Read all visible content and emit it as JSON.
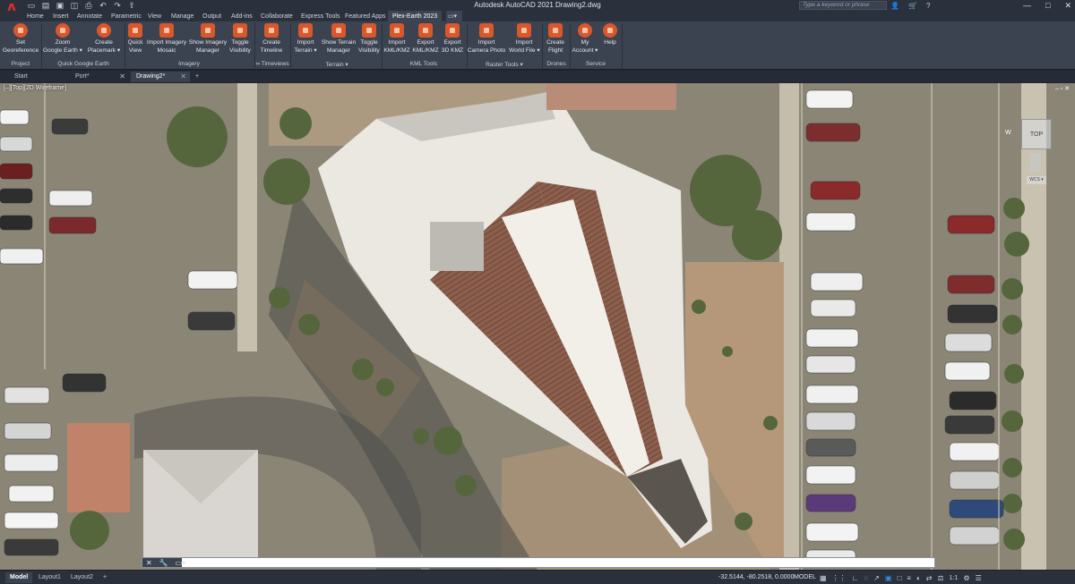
{
  "window": {
    "title": "Autodesk AutoCAD 2021    Drawing2.dwg",
    "search_placeholder": "Type a keyword or phrase",
    "controls": [
      "—",
      "□",
      "✕"
    ],
    "right_icons": [
      "user-icon",
      "cart-icon",
      "help-icon"
    ]
  },
  "app_logo": "A",
  "quick_access": [
    "new-icon",
    "open-icon",
    "save-icon",
    "saveas-icon",
    "plot-icon",
    "undo-icon",
    "redo-icon",
    "share-icon"
  ],
  "ribbon_tabs": [
    {
      "label": "Home"
    },
    {
      "label": "Insert"
    },
    {
      "label": "Annotate"
    },
    {
      "label": "Parametric"
    },
    {
      "label": "View"
    },
    {
      "label": "Manage"
    },
    {
      "label": "Output"
    },
    {
      "label": "Add-ins"
    },
    {
      "label": "Collaborate"
    },
    {
      "label": "Express Tools"
    },
    {
      "label": "Featured Apps"
    },
    {
      "label": "Plex-Earth 2023",
      "active": true
    }
  ],
  "ribbon": {
    "buttons": [
      {
        "label1": "Set",
        "label2": "Georeference",
        "icon": "georeference-icon"
      },
      {
        "label1": "Zoom",
        "label2": "Google Earth ▾",
        "icon": "zoom-earth-icon"
      },
      {
        "label1": "Create",
        "label2": "Placemark ▾",
        "icon": "placemark-icon"
      },
      {
        "label1": "Quick",
        "label2": "View",
        "icon": "quick-view-icon"
      },
      {
        "label1": "Import Imagery",
        "label2": "Mosaic",
        "icon": "import-imagery-icon"
      },
      {
        "label1": "Show Imagery",
        "label2": "Manager",
        "icon": "imagery-manager-icon"
      },
      {
        "label1": "Toggle",
        "label2": "Visibility",
        "icon": "toggle-visibility-icon"
      },
      {
        "label1": "Create",
        "label2": "Timeline",
        "icon": "timeline-icon"
      },
      {
        "label1": "Import",
        "label2": "Terrain ▾",
        "icon": "import-terrain-icon"
      },
      {
        "label1": "Show Terrain",
        "label2": "Manager",
        "icon": "terrain-manager-icon"
      },
      {
        "label1": "Toggle",
        "label2": "Visibility",
        "icon": "terrain-visibility-icon"
      },
      {
        "label1": "Import",
        "label2": "KML/KMZ",
        "icon": "import-kml-icon"
      },
      {
        "label1": "Export",
        "label2": "KML/KMZ",
        "icon": "export-kml-icon"
      },
      {
        "label1": "Export",
        "label2": "3D KMZ",
        "icon": "export-3dkmz-icon"
      },
      {
        "label1": "Import",
        "label2": "Camera Photo",
        "icon": "camera-photo-icon"
      },
      {
        "label1": "Import",
        "label2": "World File ▾",
        "icon": "world-file-icon"
      },
      {
        "label1": "Create",
        "label2": "Flight",
        "icon": "flight-icon"
      },
      {
        "label1": "My",
        "label2": "Account ▾",
        "icon": "account-icon"
      },
      {
        "label1": "Help",
        "label2": "",
        "icon": "help-icon"
      }
    ],
    "groups": [
      {
        "label": "Project"
      },
      {
        "label": "Quick Google Earth"
      },
      {
        "label": "Imagery"
      },
      {
        "label": "∞ Timeviews"
      },
      {
        "label": "Terrain ▾"
      },
      {
        "label": "KML Tools"
      },
      {
        "label": "Raster Tools ▾"
      },
      {
        "label": "Drones"
      },
      {
        "label": "Service"
      }
    ]
  },
  "doc_tabs": [
    {
      "label": "Start"
    },
    {
      "label": "Port*"
    },
    {
      "label": "Drawing2*",
      "active": true
    },
    {
      "label": "+"
    }
  ],
  "viewport": {
    "label": "[–][Top][2D Wireframe]",
    "controls": "–  ▫  ✕",
    "viewcube": "TOP",
    "compass_w": "W",
    "wcs": "WCS ▾"
  },
  "command_line": {
    "buttons": [
      "✕",
      "🔧",
      "▭▾"
    ],
    "placeholder": ""
  },
  "layout_tabs": [
    {
      "label": "Model",
      "active": true
    },
    {
      "label": "Layout1"
    },
    {
      "label": "Layout2"
    },
    {
      "label": "+"
    }
  ],
  "status": {
    "coords": "-32.5144, -80.2518, 0.0000",
    "model": "MODEL",
    "icons": [
      "grid-icon",
      "snap-icon",
      "ortho-icon",
      "polar-icon",
      "isodraft-icon",
      "osnap-track-icon",
      "osnap-icon",
      "lineweight-icon",
      "transparency-icon",
      "select-cycle-icon",
      "annotation-scale-icon",
      "workspace-icon",
      "customize-icon"
    ],
    "scale": "1:1"
  },
  "colors": {
    "accent": "#d9572a",
    "ribbon_bg": "#3b4351",
    "title_bg": "#2a313d",
    "roof_white": "#ece9e3",
    "roof_brown": "#8a5e4c",
    "asphalt": "#8c877a"
  }
}
